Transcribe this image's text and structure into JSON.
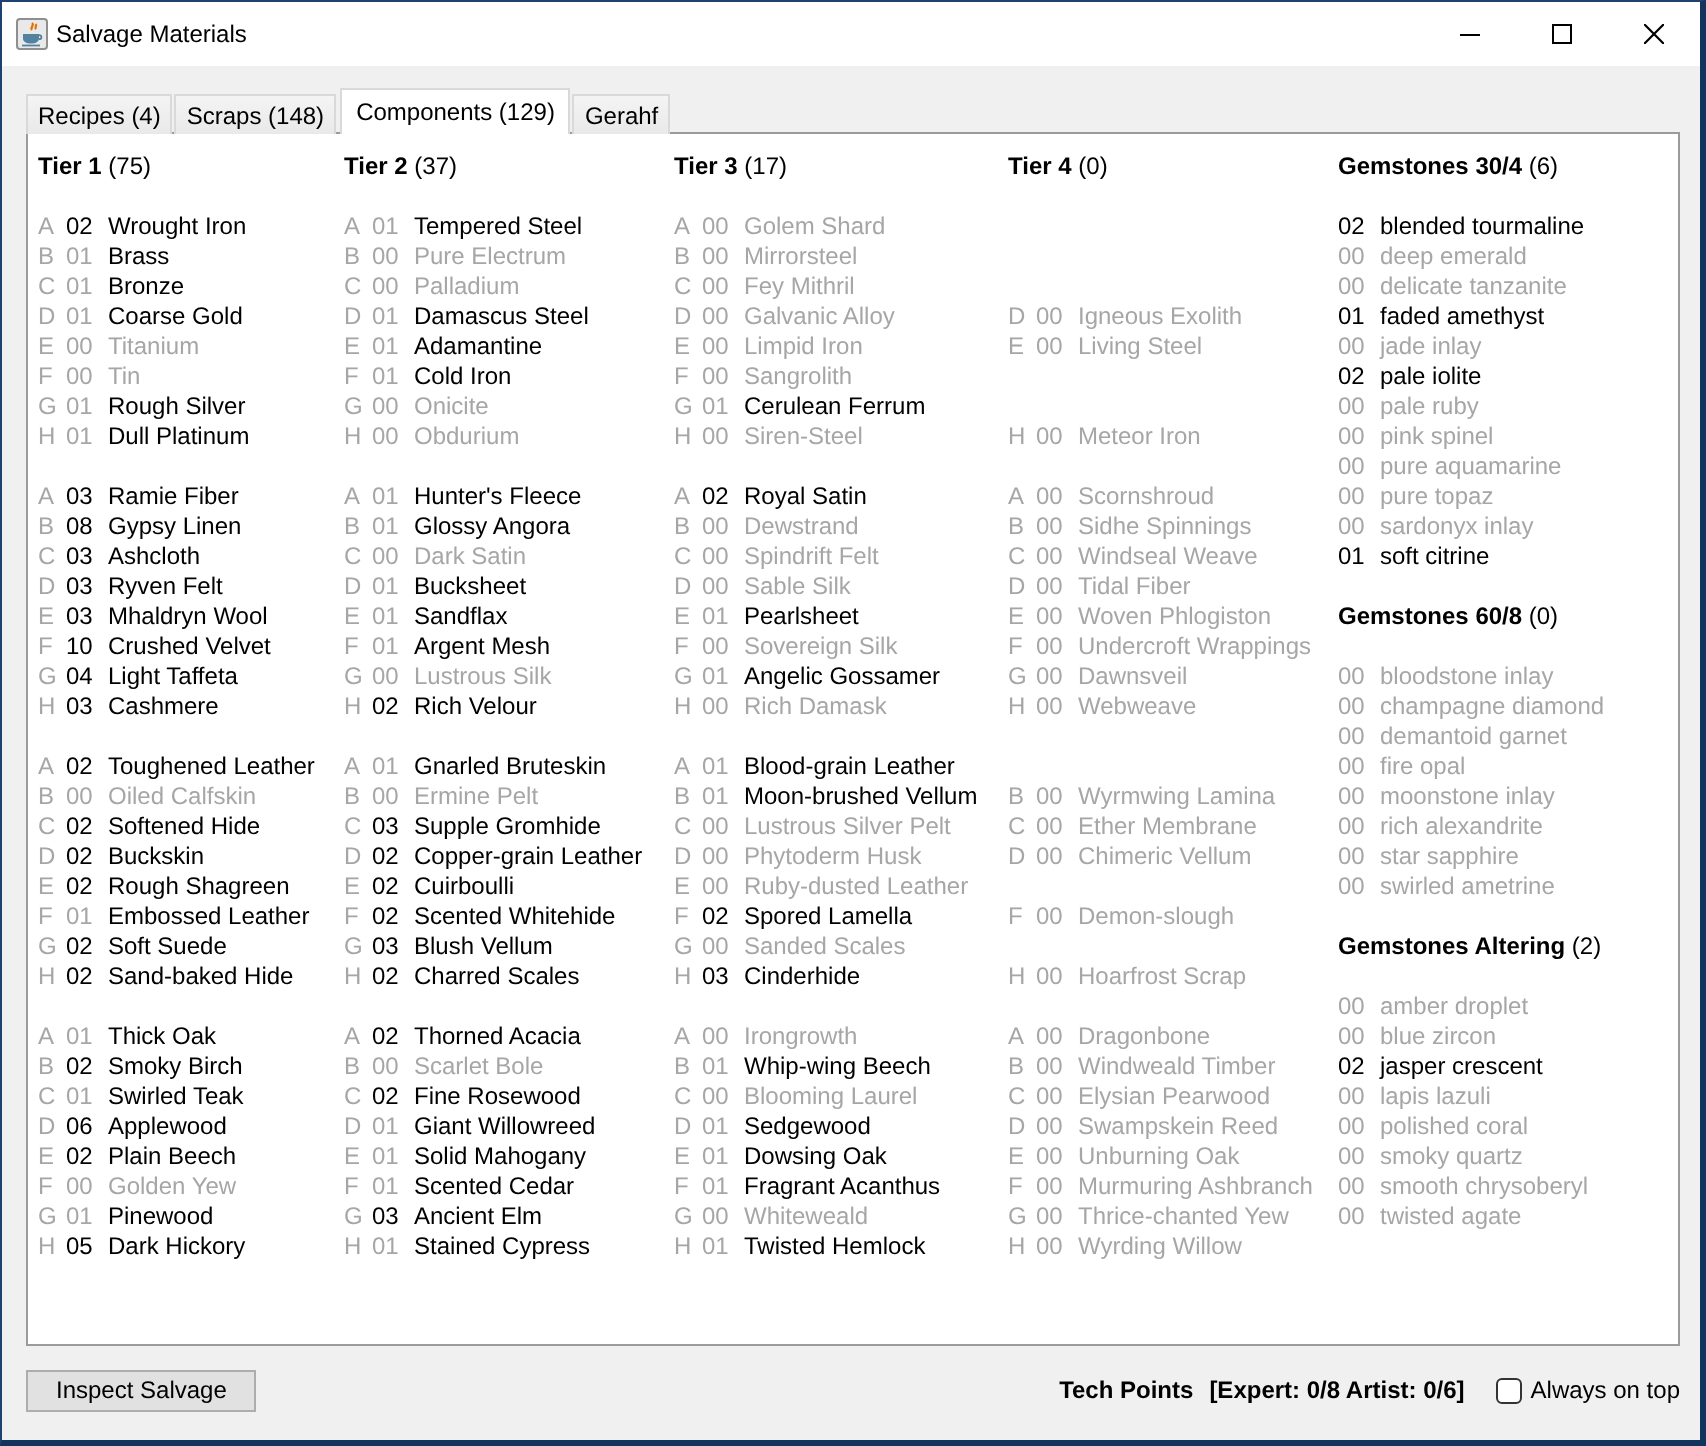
{
  "window": {
    "title": "Salvage Materials"
  },
  "tabs": [
    {
      "label": "Recipes (4)",
      "selected": false
    },
    {
      "label": "Scraps (148)",
      "selected": false
    },
    {
      "label": "Components (129)",
      "selected": true
    },
    {
      "label": "Gerahf",
      "selected": false
    }
  ],
  "tier_headings": [
    "**Tier 1** (75)",
    "**Tier 2** (37)",
    "**Tier 3** (17)",
    "**Tier 4** (0)"
  ],
  "bands": [
    {
      "rows": [
        {
          "cells": [
            {
              "letter": "A",
              "count": "02",
              "name": "Wrought Iron",
              "active": true,
              "count_active": true
            },
            {
              "letter": "A",
              "count": "01",
              "name": "Tempered Steel",
              "active": true,
              "count_active": false
            },
            {
              "letter": "A",
              "count": "00",
              "name": "Golem Shard",
              "active": false,
              "count_active": false
            }
          ]
        },
        {
          "cells": [
            {
              "letter": "B",
              "count": "01",
              "name": "Brass",
              "active": true,
              "count_active": false
            },
            {
              "letter": "B",
              "count": "00",
              "name": "Pure Electrum",
              "active": false,
              "count_active": false
            },
            {
              "letter": "B",
              "count": "00",
              "name": "Mirrorsteel",
              "active": false,
              "count_active": false
            }
          ]
        },
        {
          "cells": [
            {
              "letter": "C",
              "count": "01",
              "name": "Bronze",
              "active": true,
              "count_active": false
            },
            {
              "letter": "C",
              "count": "00",
              "name": "Palladium",
              "active": false,
              "count_active": false
            },
            {
              "letter": "C",
              "count": "00",
              "name": "Fey Mithril",
              "active": false,
              "count_active": false
            }
          ]
        },
        {
          "cells": [
            {
              "letter": "D",
              "count": "01",
              "name": "Coarse Gold",
              "active": true,
              "count_active": false
            },
            {
              "letter": "D",
              "count": "01",
              "name": "Damascus Steel",
              "active": true,
              "count_active": false
            },
            {
              "letter": "D",
              "count": "00",
              "name": "Galvanic Alloy",
              "active": false,
              "count_active": false
            },
            {
              "letter": "D",
              "count": "00",
              "name": "Igneous Exolith",
              "active": false,
              "count_active": false
            }
          ]
        },
        {
          "cells": [
            {
              "letter": "E",
              "count": "00",
              "name": "Titanium",
              "active": false,
              "count_active": false
            },
            {
              "letter": "E",
              "count": "01",
              "name": "Adamantine",
              "active": true,
              "count_active": false
            },
            {
              "letter": "E",
              "count": "00",
              "name": "Limpid Iron",
              "active": false,
              "count_active": false
            },
            {
              "letter": "E",
              "count": "00",
              "name": "Living Steel",
              "active": false,
              "count_active": false
            }
          ]
        },
        {
          "cells": [
            {
              "letter": "F",
              "count": "00",
              "name": "Tin",
              "active": false,
              "count_active": false
            },
            {
              "letter": "F",
              "count": "01",
              "name": "Cold Iron",
              "active": true,
              "count_active": false
            },
            {
              "letter": "F",
              "count": "00",
              "name": "Sangrolith",
              "active": false,
              "count_active": false
            }
          ]
        },
        {
          "cells": [
            {
              "letter": "G",
              "count": "01",
              "name": "Rough Silver",
              "active": true,
              "count_active": false
            },
            {
              "letter": "G",
              "count": "00",
              "name": "Onicite",
              "active": false,
              "count_active": false
            },
            {
              "letter": "G",
              "count": "01",
              "name": "Cerulean Ferrum",
              "active": true,
              "count_active": false
            }
          ]
        },
        {
          "cells": [
            {
              "letter": "H",
              "count": "01",
              "name": "Dull Platinum",
              "active": true,
              "count_active": false
            },
            {
              "letter": "H",
              "count": "00",
              "name": "Obdurium",
              "active": false,
              "count_active": false
            },
            {
              "letter": "H",
              "count": "00",
              "name": "Siren-Steel",
              "active": false,
              "count_active": false
            },
            {
              "letter": "H",
              "count": "00",
              "name": "Meteor Iron",
              "active": false,
              "count_active": false
            }
          ]
        }
      ]
    },
    {
      "rows": [
        {
          "cells": [
            {
              "letter": "A",
              "count": "03",
              "name": "Ramie Fiber",
              "active": true,
              "count_active": true
            },
            {
              "letter": "A",
              "count": "01",
              "name": "Hunter's Fleece",
              "active": true,
              "count_active": false
            },
            {
              "letter": "A",
              "count": "02",
              "name": "Royal Satin",
              "active": true,
              "count_active": true
            },
            {
              "letter": "A",
              "count": "00",
              "name": "Scornshroud",
              "active": false,
              "count_active": false
            }
          ]
        },
        {
          "cells": [
            {
              "letter": "B",
              "count": "08",
              "name": "Gypsy Linen",
              "active": true,
              "count_active": true
            },
            {
              "letter": "B",
              "count": "01",
              "name": "Glossy Angora",
              "active": true,
              "count_active": false
            },
            {
              "letter": "B",
              "count": "00",
              "name": "Dewstrand",
              "active": false,
              "count_active": false
            },
            {
              "letter": "B",
              "count": "00",
              "name": "Sidhe Spinnings",
              "active": false,
              "count_active": false
            }
          ]
        },
        {
          "cells": [
            {
              "letter": "C",
              "count": "03",
              "name": "Ashcloth",
              "active": true,
              "count_active": true
            },
            {
              "letter": "C",
              "count": "00",
              "name": "Dark Satin",
              "active": false,
              "count_active": false
            },
            {
              "letter": "C",
              "count": "00",
              "name": "Spindrift Felt",
              "active": false,
              "count_active": false
            },
            {
              "letter": "C",
              "count": "00",
              "name": "Windseal Weave",
              "active": false,
              "count_active": false
            }
          ]
        },
        {
          "cells": [
            {
              "letter": "D",
              "count": "03",
              "name": "Ryven Felt",
              "active": true,
              "count_active": true
            },
            {
              "letter": "D",
              "count": "01",
              "name": "Bucksheet",
              "active": true,
              "count_active": false
            },
            {
              "letter": "D",
              "count": "00",
              "name": "Sable Silk",
              "active": false,
              "count_active": false
            },
            {
              "letter": "D",
              "count": "00",
              "name": "Tidal Fiber",
              "active": false,
              "count_active": false
            }
          ]
        },
        {
          "cells": [
            {
              "letter": "E",
              "count": "03",
              "name": "Mhaldryn Wool",
              "active": true,
              "count_active": true
            },
            {
              "letter": "E",
              "count": "01",
              "name": "Sandflax",
              "active": true,
              "count_active": false
            },
            {
              "letter": "E",
              "count": "01",
              "name": "Pearlsheet",
              "active": true,
              "count_active": false
            },
            {
              "letter": "E",
              "count": "00",
              "name": "Woven Phlogiston",
              "active": false,
              "count_active": false
            }
          ]
        },
        {
          "cells": [
            {
              "letter": "F",
              "count": "10",
              "name": "Crushed Velvet",
              "active": true,
              "count_active": true
            },
            {
              "letter": "F",
              "count": "01",
              "name": "Argent Mesh",
              "active": true,
              "count_active": false
            },
            {
              "letter": "F",
              "count": "00",
              "name": "Sovereign Silk",
              "active": false,
              "count_active": false
            },
            {
              "letter": "F",
              "count": "00",
              "name": "Undercroft Wrappings",
              "active": false,
              "count_active": false
            }
          ]
        },
        {
          "cells": [
            {
              "letter": "G",
              "count": "04",
              "name": "Light Taffeta",
              "active": true,
              "count_active": true
            },
            {
              "letter": "G",
              "count": "00",
              "name": "Lustrous Silk",
              "active": false,
              "count_active": false
            },
            {
              "letter": "G",
              "count": "01",
              "name": "Angelic Gossamer",
              "active": true,
              "count_active": false
            },
            {
              "letter": "G",
              "count": "00",
              "name": "Dawnsveil",
              "active": false,
              "count_active": false
            }
          ]
        },
        {
          "cells": [
            {
              "letter": "H",
              "count": "03",
              "name": "Cashmere",
              "active": true,
              "count_active": true
            },
            {
              "letter": "H",
              "count": "02",
              "name": "Rich Velour",
              "active": true,
              "count_active": true
            },
            {
              "letter": "H",
              "count": "00",
              "name": "Rich Damask",
              "active": false,
              "count_active": false
            },
            {
              "letter": "H",
              "count": "00",
              "name": "Webweave",
              "active": false,
              "count_active": false
            }
          ]
        }
      ]
    },
    {
      "rows": [
        {
          "cells": [
            {
              "letter": "A",
              "count": "02",
              "name": "Toughened Leather",
              "active": true,
              "count_active": true
            },
            {
              "letter": "A",
              "count": "01",
              "name": "Gnarled Bruteskin",
              "active": true,
              "count_active": false
            },
            {
              "letter": "A",
              "count": "01",
              "name": "Blood-grain Leather",
              "active": true,
              "count_active": false
            }
          ]
        },
        {
          "cells": [
            {
              "letter": "B",
              "count": "00",
              "name": "Oiled Calfskin",
              "active": false,
              "count_active": false
            },
            {
              "letter": "B",
              "count": "00",
              "name": "Ermine Pelt",
              "active": false,
              "count_active": false
            },
            {
              "letter": "B",
              "count": "01",
              "name": "Moon-brushed Vellum",
              "active": true,
              "count_active": false
            },
            {
              "letter": "B",
              "count": "00",
              "name": "Wyrmwing Lamina",
              "active": false,
              "count_active": false
            }
          ]
        },
        {
          "cells": [
            {
              "letter": "C",
              "count": "02",
              "name": "Softened Hide",
              "active": true,
              "count_active": true
            },
            {
              "letter": "C",
              "count": "03",
              "name": "Supple Gromhide",
              "active": true,
              "count_active": true
            },
            {
              "letter": "C",
              "count": "00",
              "name": "Lustrous Silver Pelt",
              "active": false,
              "count_active": false
            },
            {
              "letter": "C",
              "count": "00",
              "name": "Ether Membrane",
              "active": false,
              "count_active": false
            }
          ]
        },
        {
          "cells": [
            {
              "letter": "D",
              "count": "02",
              "name": "Buckskin",
              "active": true,
              "count_active": true
            },
            {
              "letter": "D",
              "count": "02",
              "name": "Copper-grain Leather",
              "active": true,
              "count_active": true
            },
            {
              "letter": "D",
              "count": "00",
              "name": "Phytoderm Husk",
              "active": false,
              "count_active": false
            },
            {
              "letter": "D",
              "count": "00",
              "name": "Chimeric Vellum",
              "active": false,
              "count_active": false
            }
          ]
        },
        {
          "cells": [
            {
              "letter": "E",
              "count": "02",
              "name": "Rough Shagreen",
              "active": true,
              "count_active": true
            },
            {
              "letter": "E",
              "count": "02",
              "name": "Cuirboulli",
              "active": true,
              "count_active": true
            },
            {
              "letter": "E",
              "count": "00",
              "name": "Ruby-dusted Leather",
              "active": false,
              "count_active": false
            }
          ]
        },
        {
          "cells": [
            {
              "letter": "F",
              "count": "01",
              "name": "Embossed Leather",
              "active": true,
              "count_active": false
            },
            {
              "letter": "F",
              "count": "02",
              "name": "Scented Whitehide",
              "active": true,
              "count_active": true
            },
            {
              "letter": "F",
              "count": "02",
              "name": "Spored Lamella",
              "active": true,
              "count_active": true
            },
            {
              "letter": "F",
              "count": "00",
              "name": "Demon-slough",
              "active": false,
              "count_active": false
            }
          ]
        },
        {
          "cells": [
            {
              "letter": "G",
              "count": "02",
              "name": "Soft Suede",
              "active": true,
              "count_active": true
            },
            {
              "letter": "G",
              "count": "03",
              "name": "Blush Vellum",
              "active": true,
              "count_active": true
            },
            {
              "letter": "G",
              "count": "00",
              "name": "Sanded Scales",
              "active": false,
              "count_active": false
            }
          ]
        },
        {
          "cells": [
            {
              "letter": "H",
              "count": "02",
              "name": "Sand-baked Hide",
              "active": true,
              "count_active": true
            },
            {
              "letter": "H",
              "count": "02",
              "name": "Charred Scales",
              "active": true,
              "count_active": true
            },
            {
              "letter": "H",
              "count": "03",
              "name": "Cinderhide",
              "active": true,
              "count_active": true
            },
            {
              "letter": "H",
              "count": "00",
              "name": "Hoarfrost Scrap",
              "active": false,
              "count_active": false
            }
          ]
        }
      ]
    },
    {
      "rows": [
        {
          "cells": [
            {
              "letter": "A",
              "count": "01",
              "name": "Thick Oak",
              "active": true,
              "count_active": false
            },
            {
              "letter": "A",
              "count": "02",
              "name": "Thorned Acacia",
              "active": true,
              "count_active": true
            },
            {
              "letter": "A",
              "count": "00",
              "name": "Irongrowth",
              "active": false,
              "count_active": false
            },
            {
              "letter": "A",
              "count": "00",
              "name": "Dragonbone",
              "active": false,
              "count_active": false
            }
          ]
        },
        {
          "cells": [
            {
              "letter": "B",
              "count": "02",
              "name": "Smoky Birch",
              "active": true,
              "count_active": true
            },
            {
              "letter": "B",
              "count": "00",
              "name": "Scarlet Bole",
              "active": false,
              "count_active": false
            },
            {
              "letter": "B",
              "count": "01",
              "name": "Whip-wing Beech",
              "active": true,
              "count_active": false
            },
            {
              "letter": "B",
              "count": "00",
              "name": "Windweald Timber",
              "active": false,
              "count_active": false
            }
          ]
        },
        {
          "cells": [
            {
              "letter": "C",
              "count": "01",
              "name": "Swirled Teak",
              "active": true,
              "count_active": false
            },
            {
              "letter": "C",
              "count": "02",
              "name": "Fine Rosewood",
              "active": true,
              "count_active": true
            },
            {
              "letter": "C",
              "count": "00",
              "name": "Blooming Laurel",
              "active": false,
              "count_active": false
            },
            {
              "letter": "C",
              "count": "00",
              "name": "Elysian Pearwood",
              "active": false,
              "count_active": false
            }
          ]
        },
        {
          "cells": [
            {
              "letter": "D",
              "count": "06",
              "name": "Applewood",
              "active": true,
              "count_active": true
            },
            {
              "letter": "D",
              "count": "01",
              "name": "Giant Willowreed",
              "active": true,
              "count_active": false
            },
            {
              "letter": "D",
              "count": "01",
              "name": "Sedgewood",
              "active": true,
              "count_active": false
            },
            {
              "letter": "D",
              "count": "00",
              "name": "Swampskein Reed",
              "active": false,
              "count_active": false
            }
          ]
        },
        {
          "cells": [
            {
              "letter": "E",
              "count": "02",
              "name": "Plain Beech",
              "active": true,
              "count_active": true
            },
            {
              "letter": "E",
              "count": "01",
              "name": "Solid Mahogany",
              "active": true,
              "count_active": false
            },
            {
              "letter": "E",
              "count": "01",
              "name": "Dowsing Oak",
              "active": true,
              "count_active": false
            },
            {
              "letter": "E",
              "count": "00",
              "name": "Unburning Oak",
              "active": false,
              "count_active": false
            }
          ]
        },
        {
          "cells": [
            {
              "letter": "F",
              "count": "00",
              "name": "Golden Yew",
              "active": false,
              "count_active": false
            },
            {
              "letter": "F",
              "count": "01",
              "name": "Scented Cedar",
              "active": true,
              "count_active": false
            },
            {
              "letter": "F",
              "count": "01",
              "name": "Fragrant Acanthus",
              "active": true,
              "count_active": false
            },
            {
              "letter": "F",
              "count": "00",
              "name": "Murmuring Ashbranch",
              "active": false,
              "count_active": false
            }
          ]
        },
        {
          "cells": [
            {
              "letter": "G",
              "count": "01",
              "name": "Pinewood",
              "active": true,
              "count_active": false
            },
            {
              "letter": "G",
              "count": "03",
              "name": "Ancient Elm",
              "active": true,
              "count_active": true
            },
            {
              "letter": "G",
              "count": "00",
              "name": "Whiteweald",
              "active": false,
              "count_active": false
            },
            {
              "letter": "G",
              "count": "00",
              "name": "Thrice-chanted Yew",
              "active": false,
              "count_active": false
            }
          ]
        },
        {
          "cells": [
            {
              "letter": "H",
              "count": "05",
              "name": "Dark Hickory",
              "active": true,
              "count_active": true
            },
            {
              "letter": "H",
              "count": "01",
              "name": "Stained Cypress",
              "active": true,
              "count_active": false
            },
            {
              "letter": "H",
              "count": "01",
              "name": "Twisted Hemlock",
              "active": true,
              "count_active": false
            },
            {
              "letter": "H",
              "count": "00",
              "name": "Wyrding Willow",
              "active": false,
              "count_active": false
            }
          ]
        }
      ]
    }
  ],
  "gem_sections": [
    {
      "heading": "**Gemstones 30/4** (6)",
      "items": [
        {
          "count": "02",
          "name": "blended tourmaline",
          "active": true
        },
        {
          "count": "00",
          "name": "deep emerald",
          "active": false
        },
        {
          "count": "00",
          "name": "delicate tanzanite",
          "active": false
        },
        {
          "count": "01",
          "name": "faded amethyst",
          "active": true
        },
        {
          "count": "00",
          "name": "jade inlay",
          "active": false
        },
        {
          "count": "02",
          "name": "pale iolite",
          "active": true
        },
        {
          "count": "00",
          "name": "pale ruby",
          "active": false
        },
        {
          "count": "00",
          "name": "pink spinel",
          "active": false
        },
        {
          "count": "00",
          "name": "pure aquamarine",
          "active": false
        },
        {
          "count": "00",
          "name": "pure topaz",
          "active": false
        },
        {
          "count": "00",
          "name": "sardonyx inlay",
          "active": false
        },
        {
          "count": "01",
          "name": "soft citrine",
          "active": true
        }
      ]
    },
    {
      "heading": "**Gemstones 60/8** (0)",
      "items": [
        {
          "count": "00",
          "name": "bloodstone inlay",
          "active": false
        },
        {
          "count": "00",
          "name": "champagne diamond",
          "active": false
        },
        {
          "count": "00",
          "name": "demantoid garnet",
          "active": false
        },
        {
          "count": "00",
          "name": "fire opal",
          "active": false
        },
        {
          "count": "00",
          "name": "moonstone inlay",
          "active": false
        },
        {
          "count": "00",
          "name": "rich alexandrite",
          "active": false
        },
        {
          "count": "00",
          "name": "star sapphire",
          "active": false
        },
        {
          "count": "00",
          "name": "swirled ametrine",
          "active": false
        }
      ]
    },
    {
      "heading": "**Gemstones Altering** (2)",
      "items": [
        {
          "count": "00",
          "name": "amber droplet",
          "active": false
        },
        {
          "count": "00",
          "name": "blue zircon",
          "active": false
        },
        {
          "count": "02",
          "name": "jasper crescent",
          "active": true
        },
        {
          "count": "00",
          "name": "lapis lazuli",
          "active": false
        },
        {
          "count": "00",
          "name": "polished coral",
          "active": false
        },
        {
          "count": "00",
          "name": "smoky quartz",
          "active": false
        },
        {
          "count": "00",
          "name": "smooth chrysoberyl",
          "active": false
        },
        {
          "count": "00",
          "name": "twisted agate",
          "active": false
        }
      ]
    }
  ],
  "inspect_button": "Inspect Salvage",
  "tech_points": {
    "label": "Tech Points",
    "value": "[Expert: 0/8 Artist: 0/6]"
  },
  "always_on_top": {
    "label": "Always on top",
    "checked": false
  }
}
